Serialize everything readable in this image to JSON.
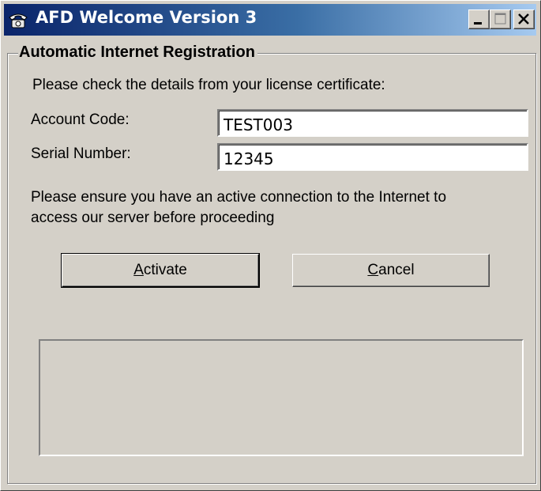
{
  "window": {
    "title": "AFD Welcome Version 3",
    "icon": "telephone-icon",
    "controls": [
      "minimize-icon",
      "maximize-icon",
      "close-icon"
    ]
  },
  "group": {
    "legend": "Automatic Internet Registration"
  },
  "form": {
    "instruction": "Please check the details from your license certificate:",
    "account_label": "Account Code:",
    "account_value": "TEST003",
    "serial_label": "Serial Number:",
    "serial_value": "12345",
    "notice_line1": "Please ensure you have an active connection to the Internet to",
    "notice_line2": "access our server before proceeding"
  },
  "buttons": {
    "activate_first": "A",
    "activate_rest": "ctivate",
    "cancel_first": "C",
    "cancel_rest": "ancel"
  },
  "status": {
    "text": ""
  },
  "colors": {
    "face": "#d4d0c8",
    "title_start": "#0a246a",
    "title_end": "#a6caf0"
  }
}
